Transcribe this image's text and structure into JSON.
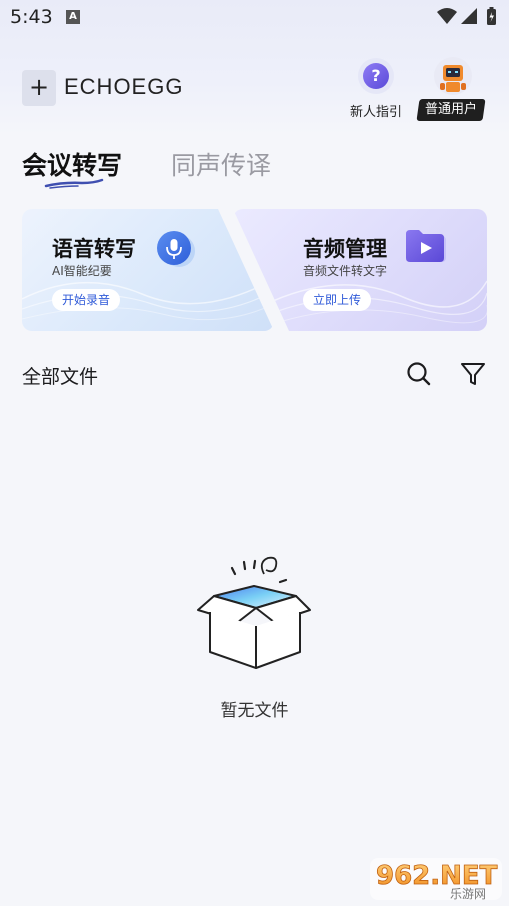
{
  "status_bar": {
    "time": "5:43",
    "notification_letter": "A"
  },
  "header": {
    "logo": "ECHOEGG",
    "guide_icon_char": "?",
    "guide_label": "新人指引",
    "user_badge": "普通用户"
  },
  "tabs": [
    {
      "label": "会议转写",
      "active": true
    },
    {
      "label": "同声传译",
      "active": false
    }
  ],
  "cards": [
    {
      "title": "语音转写",
      "subtitle": "AI智能纪要",
      "button": "开始录音",
      "icon": "microphone-icon"
    },
    {
      "title": "音频管理",
      "subtitle": "音频文件转文字",
      "button": "立即上传",
      "icon": "video-folder-icon"
    }
  ],
  "files": {
    "title": "全部文件",
    "empty_text": "暂无文件"
  },
  "watermark": {
    "brand": "962.NET",
    "sub": "乐游网"
  },
  "colors": {
    "accent": "#2f5ad8",
    "purple": "#6a5ae0",
    "background": "#f5f6fa"
  }
}
